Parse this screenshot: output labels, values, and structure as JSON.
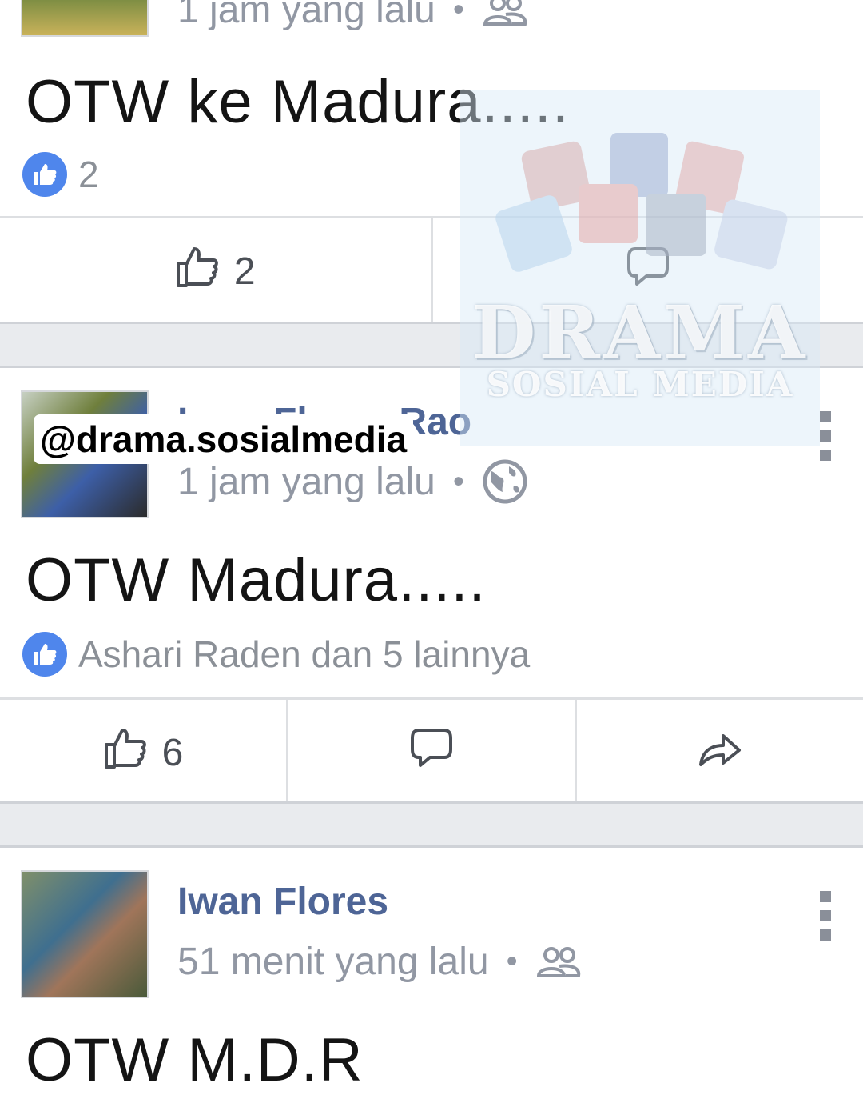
{
  "posts": [
    {
      "meta": "1 jam yang lalu",
      "privacy_icon": "friends-icon",
      "text": "OTW ke Madura.....",
      "reaction_summary": "2",
      "actions": {
        "like_count": "2"
      }
    },
    {
      "author": "Iwan Flores Rao",
      "meta": "1 jam yang lalu",
      "privacy_icon": "globe-icon",
      "text": "OTW Madura.....",
      "reaction_summary": "Ashari Raden dan 5 lainnya",
      "actions": {
        "like_count": "6"
      }
    },
    {
      "author": "Iwan Flores",
      "meta": "51 menit yang lalu",
      "privacy_icon": "friends-icon",
      "text": "OTW M.D.R"
    }
  ],
  "watermark": {
    "title": "DRAMA",
    "subtitle": "SOSIAL MEDIA",
    "handle": "@drama.sosialmedia",
    "icons": [
      "instagram-icon",
      "facebook-icon",
      "youtube-icon",
      "twitter-icon",
      "google-plus-icon",
      "tumblr-icon",
      "like-icon"
    ]
  },
  "colors": {
    "like_blue": "#4f86ec",
    "name_blue": "#4e6596",
    "meta_gray": "#9197a3",
    "separator": "#e9ebee"
  }
}
